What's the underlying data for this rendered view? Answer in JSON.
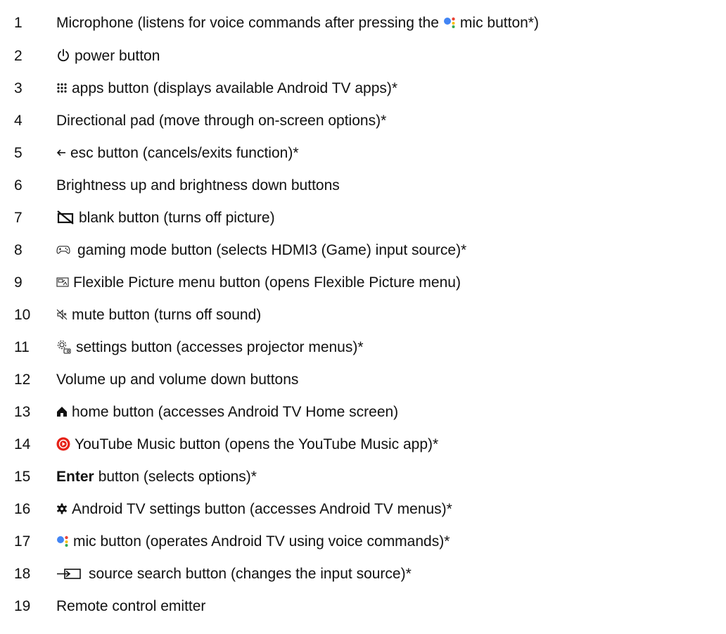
{
  "items": [
    {
      "num": "1",
      "pre": "Microphone (listens for voice commands after pressing the",
      "icon": "google-assistant-icon",
      "text": "mic button*)"
    },
    {
      "num": "2",
      "icon": "power-icon",
      "text": "power button"
    },
    {
      "num": "3",
      "icon": "apps-grid-icon",
      "text": "apps button (displays available Android TV apps)*"
    },
    {
      "num": "4",
      "text": "Directional pad (move through on-screen options)*"
    },
    {
      "num": "5",
      "icon": "back-arrow-icon",
      "text": "esc button (cancels/exits function)*"
    },
    {
      "num": "6",
      "text": "Brightness up and brightness down buttons"
    },
    {
      "num": "7",
      "icon": "blank-screen-icon",
      "text": "blank button (turns off picture)"
    },
    {
      "num": "8",
      "icon": "gamepad-icon",
      "text": "gaming mode button (selects HDMI3 (Game) input source)*"
    },
    {
      "num": "9",
      "icon": "flexible-picture-icon",
      "text": "Flexible Picture menu button (opens Flexible Picture menu)"
    },
    {
      "num": "10",
      "icon": "mute-icon",
      "text": "mute button (turns off sound)"
    },
    {
      "num": "11",
      "icon": "projector-settings-icon",
      "text": "settings button (accesses projector menus)*"
    },
    {
      "num": "12",
      "text": "Volume up and volume down buttons"
    },
    {
      "num": "13",
      "icon": "home-icon",
      "text": "home button (accesses Android TV Home screen)"
    },
    {
      "num": "14",
      "icon": "youtube-music-icon",
      "text": "YouTube Music button (opens the YouTube Music app)*"
    },
    {
      "num": "15",
      "bold": "Enter",
      "text": "button (selects options)*"
    },
    {
      "num": "16",
      "icon": "gear-icon",
      "text": "Android TV settings button (accesses Android TV menus)*"
    },
    {
      "num": "17",
      "icon": "google-assistant-icon",
      "text": "mic button (operates Android TV using voice commands)*"
    },
    {
      "num": "18",
      "icon": "source-search-icon",
      "text": "source search button (changes the input source)*"
    },
    {
      "num": "19",
      "text": "Remote control emitter"
    }
  ],
  "colors": {
    "text": "#111111",
    "assistant_blue": "#4285F4",
    "assistant_red": "#EA4335",
    "assistant_yellow": "#FBBC05",
    "assistant_green": "#34A853",
    "youtube_red": "#E62117"
  }
}
